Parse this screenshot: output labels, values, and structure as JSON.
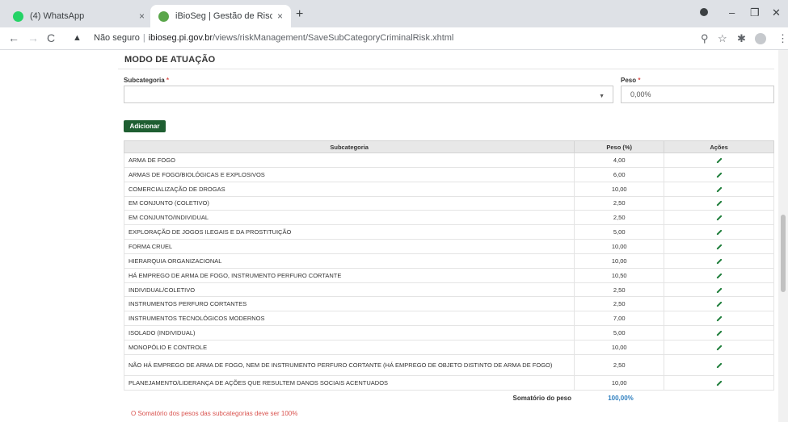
{
  "browser": {
    "tabs": [
      {
        "title": "(4) WhatsApp",
        "favicon_color": "#25d366",
        "active": false
      },
      {
        "title": "iBioSeg | Gestão de Risco",
        "favicon_color": "#5aa64a",
        "active": true
      }
    ],
    "new_tab_symbol": "+",
    "close_symbol": "×",
    "window_controls": {
      "minimize": "–",
      "maximize": "❐",
      "close": "✕"
    },
    "security_label": "Não seguro",
    "url_host": "ibioseg.pi.gov.br",
    "url_path": "/views/riskManagement/SaveSubCategoryCriminalRisk.xhtml",
    "icons": [
      "back-icon",
      "forward-icon",
      "reload-icon",
      "warning-icon",
      "zoom-icon",
      "star-icon",
      "extensions-icon",
      "profile-icon",
      "menu-icon"
    ]
  },
  "form": {
    "section_title": "MODO DE ATUAÇÃO",
    "subcategoria_label": "Subcategoria",
    "peso_label": "Peso",
    "required_mark": "*",
    "subcategoria_value": "",
    "peso_value": "0,00%",
    "add_button": "Adicionar"
  },
  "table": {
    "headers": {
      "subcategoria": "Subcategoria",
      "peso": "Peso (%)",
      "acoes": "Ações"
    },
    "rows": [
      {
        "sub": "ARMA DE FOGO",
        "peso": "4,00"
      },
      {
        "sub": "ARMAS DE FOGO/BIOLÓGICAS E EXPLOSIVOS",
        "peso": "6,00"
      },
      {
        "sub": "COMERCIALIZAÇÃO DE DROGAS",
        "peso": "10,00"
      },
      {
        "sub": "EM CONJUNTO (COLETIVO)",
        "peso": "2,50"
      },
      {
        "sub": "EM CONJUNTO/INDIVIDUAL",
        "peso": "2,50"
      },
      {
        "sub": "EXPLORAÇÃO DE JOGOS ILEGAIS E DA PROSTITUIÇÃO",
        "peso": "5,00"
      },
      {
        "sub": "FORMA CRUEL",
        "peso": "10,00"
      },
      {
        "sub": "HIERARQUIA ORGANIZACIONAL",
        "peso": "10,00"
      },
      {
        "sub": "HÁ EMPREGO DE ARMA DE FOGO, INSTRUMENTO PERFURO CORTANTE",
        "peso": "10,50"
      },
      {
        "sub": "INDIVIDUAL/COLETIVO",
        "peso": "2,50"
      },
      {
        "sub": "INSTRUMENTOS PERFURO CORTANTES",
        "peso": "2,50"
      },
      {
        "sub": "INSTRUMENTOS TECNOLÓGICOS MODERNOS",
        "peso": "7,00"
      },
      {
        "sub": "ISOLADO (INDIVIDUAL)",
        "peso": "5,00"
      },
      {
        "sub": "MONOPÓLIO E CONTROLE",
        "peso": "10,00"
      },
      {
        "sub": "NÃO HÁ EMPREGO DE ARMA DE FOGO, NEM DE INSTRUMENTO PERFURO CORTANTE (HÁ EMPREGO DE OBJETO DISTINTO DE ARMA DE FOGO)",
        "peso": "2,50"
      },
      {
        "sub": "PLANEJAMENTO/LIDERANÇA DE AÇÕES QUE RESULTEM DANOS SOCIAIS ACENTUADOS",
        "peso": "10,00"
      }
    ],
    "sum_label": "Somatório do peso",
    "sum_value": "100,00%",
    "warning": "O Somatório dos pesos das subcategorias deve ser 100%"
  },
  "colors": {
    "primary_button": "#1e5e31",
    "edit_icon": "#1e7d3a",
    "sum_value": "#2f7fbf",
    "warning_text": "#d9534f"
  }
}
